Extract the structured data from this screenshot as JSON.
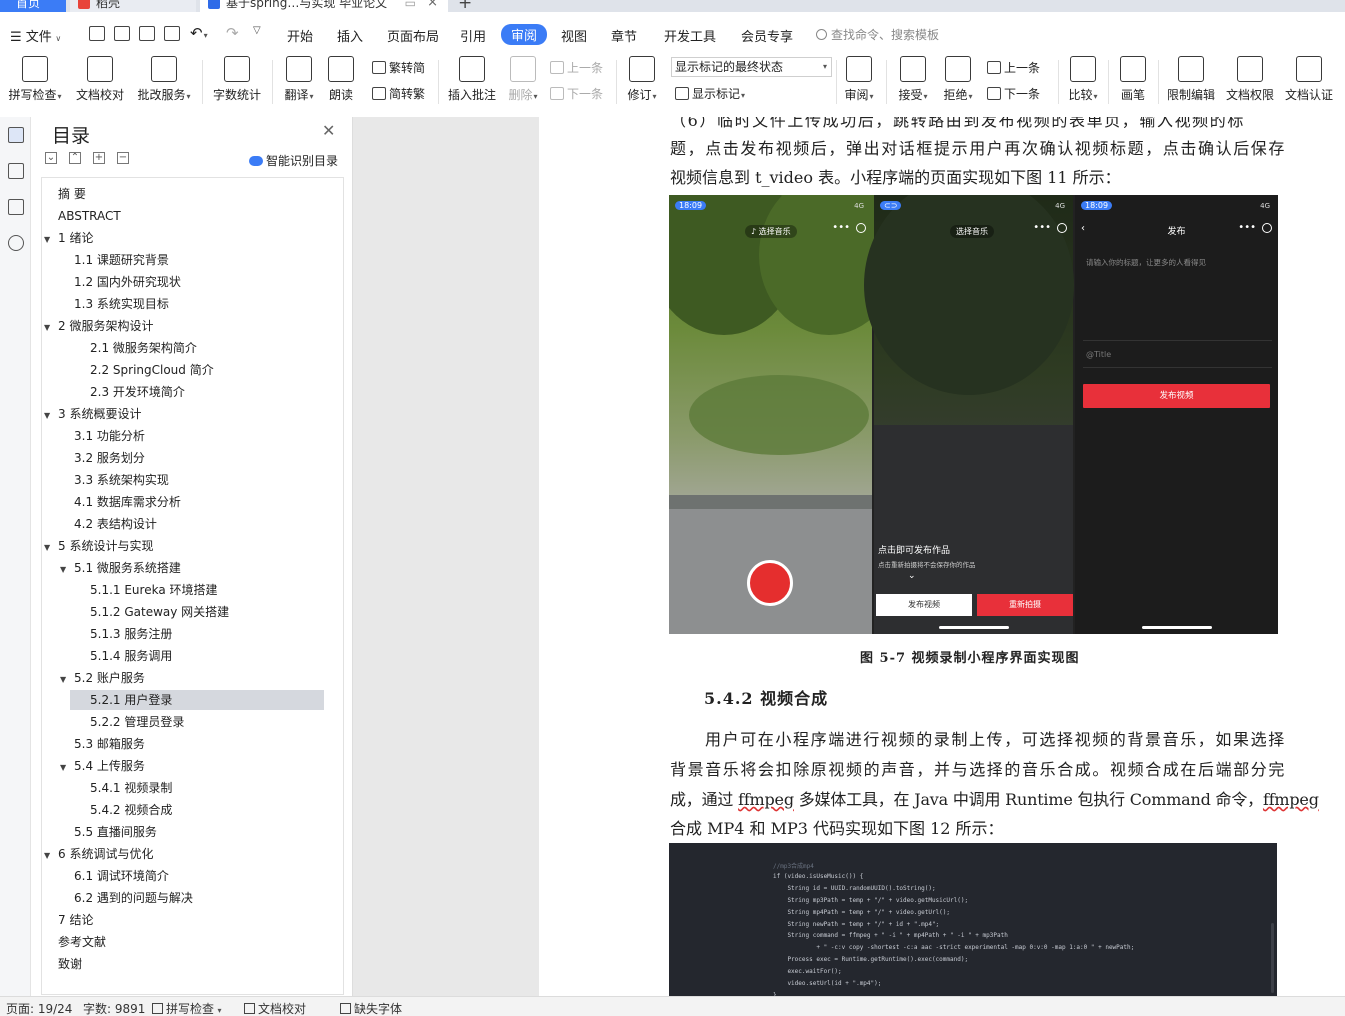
{
  "tabs": {
    "home": "首页",
    "pictures": "稻壳",
    "document": "基于spring…与实现 毕业论文"
  },
  "menu": {
    "file": "文件",
    "items": [
      "开始",
      "插入",
      "页面布局",
      "引用",
      "审阅",
      "视图",
      "章节",
      "开发工具",
      "会员专享"
    ],
    "active": "审阅",
    "search_placeholder": "查找命令、搜索模板"
  },
  "ribbon": {
    "spellcheck": "拼写检查",
    "doc_proof": "文档校对",
    "batch_service": "批改服务",
    "word_count": "字数统计",
    "translate": "翻译",
    "read_aloud": "朗读",
    "to_traditional": "繁转简",
    "to_simplified": "简转繁",
    "insert_comment": "插入批注",
    "delete": "删除",
    "prev_comment": "上一条",
    "next_comment": "下一条",
    "revise": "修订",
    "markup_state": "显示标记的最终状态",
    "show_markup": "显示标记",
    "review": "审阅",
    "accept": "接受",
    "reject": "拒绝",
    "prev_change": "上一条",
    "next_change": "下一条",
    "compare": "比较",
    "pen": "画笔",
    "restrict_edit": "限制编辑",
    "doc_permission": "文档权限",
    "doc_certify": "文档认证"
  },
  "toc": {
    "title": "目录",
    "smart_toc": "智能识别目录",
    "items": [
      {
        "level": 1,
        "text": "摘  要",
        "arrow": ""
      },
      {
        "level": 1,
        "text": "ABSTRACT",
        "arrow": ""
      },
      {
        "level": 1,
        "text": "1  绪论",
        "arrow": "▼"
      },
      {
        "level": 2,
        "text": "1.1  课题研究背景",
        "arrow": ""
      },
      {
        "level": 2,
        "text": "1.2  国内外研究现状",
        "arrow": ""
      },
      {
        "level": 2,
        "text": "1.3  系统实现目标",
        "arrow": ""
      },
      {
        "level": 1,
        "text": "2  微服务架构设计",
        "arrow": "▼"
      },
      {
        "level": 3,
        "text": "2.1  微服务架构简介",
        "arrow": ""
      },
      {
        "level": 3,
        "text": "2.2 SpringCloud 简介",
        "arrow": ""
      },
      {
        "level": 3,
        "text": "2.3  开发环境简介",
        "arrow": ""
      },
      {
        "level": 1,
        "text": "3  系统概要设计",
        "arrow": "▼"
      },
      {
        "level": 2,
        "text": "3.1  功能分析",
        "arrow": ""
      },
      {
        "level": 2,
        "text": "3.2  服务划分",
        "arrow": ""
      },
      {
        "level": 2,
        "text": "3.3  系统架构实现",
        "arrow": ""
      },
      {
        "level": 2,
        "text": "4.1  数据库需求分析",
        "arrow": ""
      },
      {
        "level": 2,
        "text": "4.2  表结构设计",
        "arrow": ""
      },
      {
        "level": 1,
        "text": "5  系统设计与实现",
        "arrow": "▼"
      },
      {
        "level": 2,
        "text": "5.1  微服务系统搭建",
        "arrow": "▼"
      },
      {
        "level": 3,
        "text": "5.1.1 Eureka 环境搭建",
        "arrow": ""
      },
      {
        "level": 3,
        "text": "5.1.2 Gateway 网关搭建",
        "arrow": ""
      },
      {
        "level": 3,
        "text": "5.1.3  服务注册",
        "arrow": ""
      },
      {
        "level": 3,
        "text": "5.1.4  服务调用",
        "arrow": ""
      },
      {
        "level": 2,
        "text": "5.2  账户服务",
        "arrow": "▼"
      },
      {
        "level": 3,
        "text": "5.2.1  用户登录",
        "arrow": "",
        "selected": true
      },
      {
        "level": 3,
        "text": "5.2.2  管理员登录",
        "arrow": ""
      },
      {
        "level": 2,
        "text": "5.3  邮箱服务",
        "arrow": ""
      },
      {
        "level": 2,
        "text": "5.4  上传服务",
        "arrow": "▼"
      },
      {
        "level": 3,
        "text": "5.4.1  视频录制",
        "arrow": ""
      },
      {
        "level": 3,
        "text": "5.4.2  视频合成",
        "arrow": ""
      },
      {
        "level": 2,
        "text": "5.5  直播间服务",
        "arrow": ""
      },
      {
        "level": 1,
        "text": "6  系统调试与优化",
        "arrow": "▼"
      },
      {
        "level": 2,
        "text": "6.1  调试环境简介",
        "arrow": ""
      },
      {
        "level": 2,
        "text": "6.2  遇到的问题与解决",
        "arrow": ""
      },
      {
        "level": 1,
        "text": "7  结论",
        "arrow": ""
      },
      {
        "level": 1,
        "text": "参考文献",
        "arrow": ""
      },
      {
        "level": 1,
        "text": "致谢",
        "arrow": ""
      }
    ]
  },
  "doc": {
    "para1": [
      "（6）临时文件上传成功后，跳转路由到发布视频的表单页，输入视频的标",
      "题，点击发布视频后，弹出对话框提示用户再次确认视频标题，点击确认后保存",
      "视频信息到 t_video 表。小程序端的页面实现如下图 11 所示："
    ],
    "figure": {
      "time1": "18:09",
      "time3": "18:09",
      "network": "4G",
      "choose_music": "选择音乐",
      "tap_to_publish": "点击即可发布作品",
      "reshoot_hint": "点击重新拍摄将不会保存你的作品",
      "publish_video": "发布视频",
      "reshoot": "重新拍摄",
      "publish_title": "发布",
      "title_placeholder": "请输入你的标题，让更多的人看得见",
      "title_tag": "@Title",
      "publish_button": "发布视频"
    },
    "caption": "图 5-7  视频录制小程序界面实现图",
    "heading": "5.4.2  视频合成",
    "para2": [
      "用户可在小程序端进行视频的录制上传，可选择视频的背景音乐，如果选择",
      "背景音乐将会扣除原视频的声音，并与选择的音乐合成。视频合成在后端部分完"
    ],
    "para2_l3a": "成，通过 ",
    "para2_l3b": "ffmpeg",
    "para2_l3c": " 多媒体工具，在 Java 中调用 Runtime 包执行 Command 命令，",
    "para2_l3d": "ffmpeg",
    "para2_l4": "合成 MP4 和 MP3 代码实现如下图 12 所示：",
    "code": [
      "//mp3合成mp4",
      "if (video.isUseMusic()) {",
      "    String id = UUID.randomUUID().toString();",
      "    String mp3Path = temp + \"/\" + video.getMusicUrl();",
      "    String mp4Path = temp + \"/\" + video.getUrl();",
      "    String newPath = temp + \"/\" + id + \".mp4\";",
      "    String command = ffmpeg + \" -i \" + mp4Path + \" -i \" + mp3Path",
      "            + \" -c:v copy -shortest -c:a aac -strict experimental -map 0:v:0 -map 1:a:0 \" + newPath;",
      "    Process exec = Runtime.getRuntime().exec(command);",
      "    exec.waitFor();",
      "    video.setUrl(id + \".mp4\");",
      "}"
    ]
  },
  "status": {
    "page": "页面: 19/24",
    "words": "字数: 9891",
    "spellcheck": "拼写检查",
    "proof": "文档校对",
    "missing_font": "缺失字体"
  }
}
